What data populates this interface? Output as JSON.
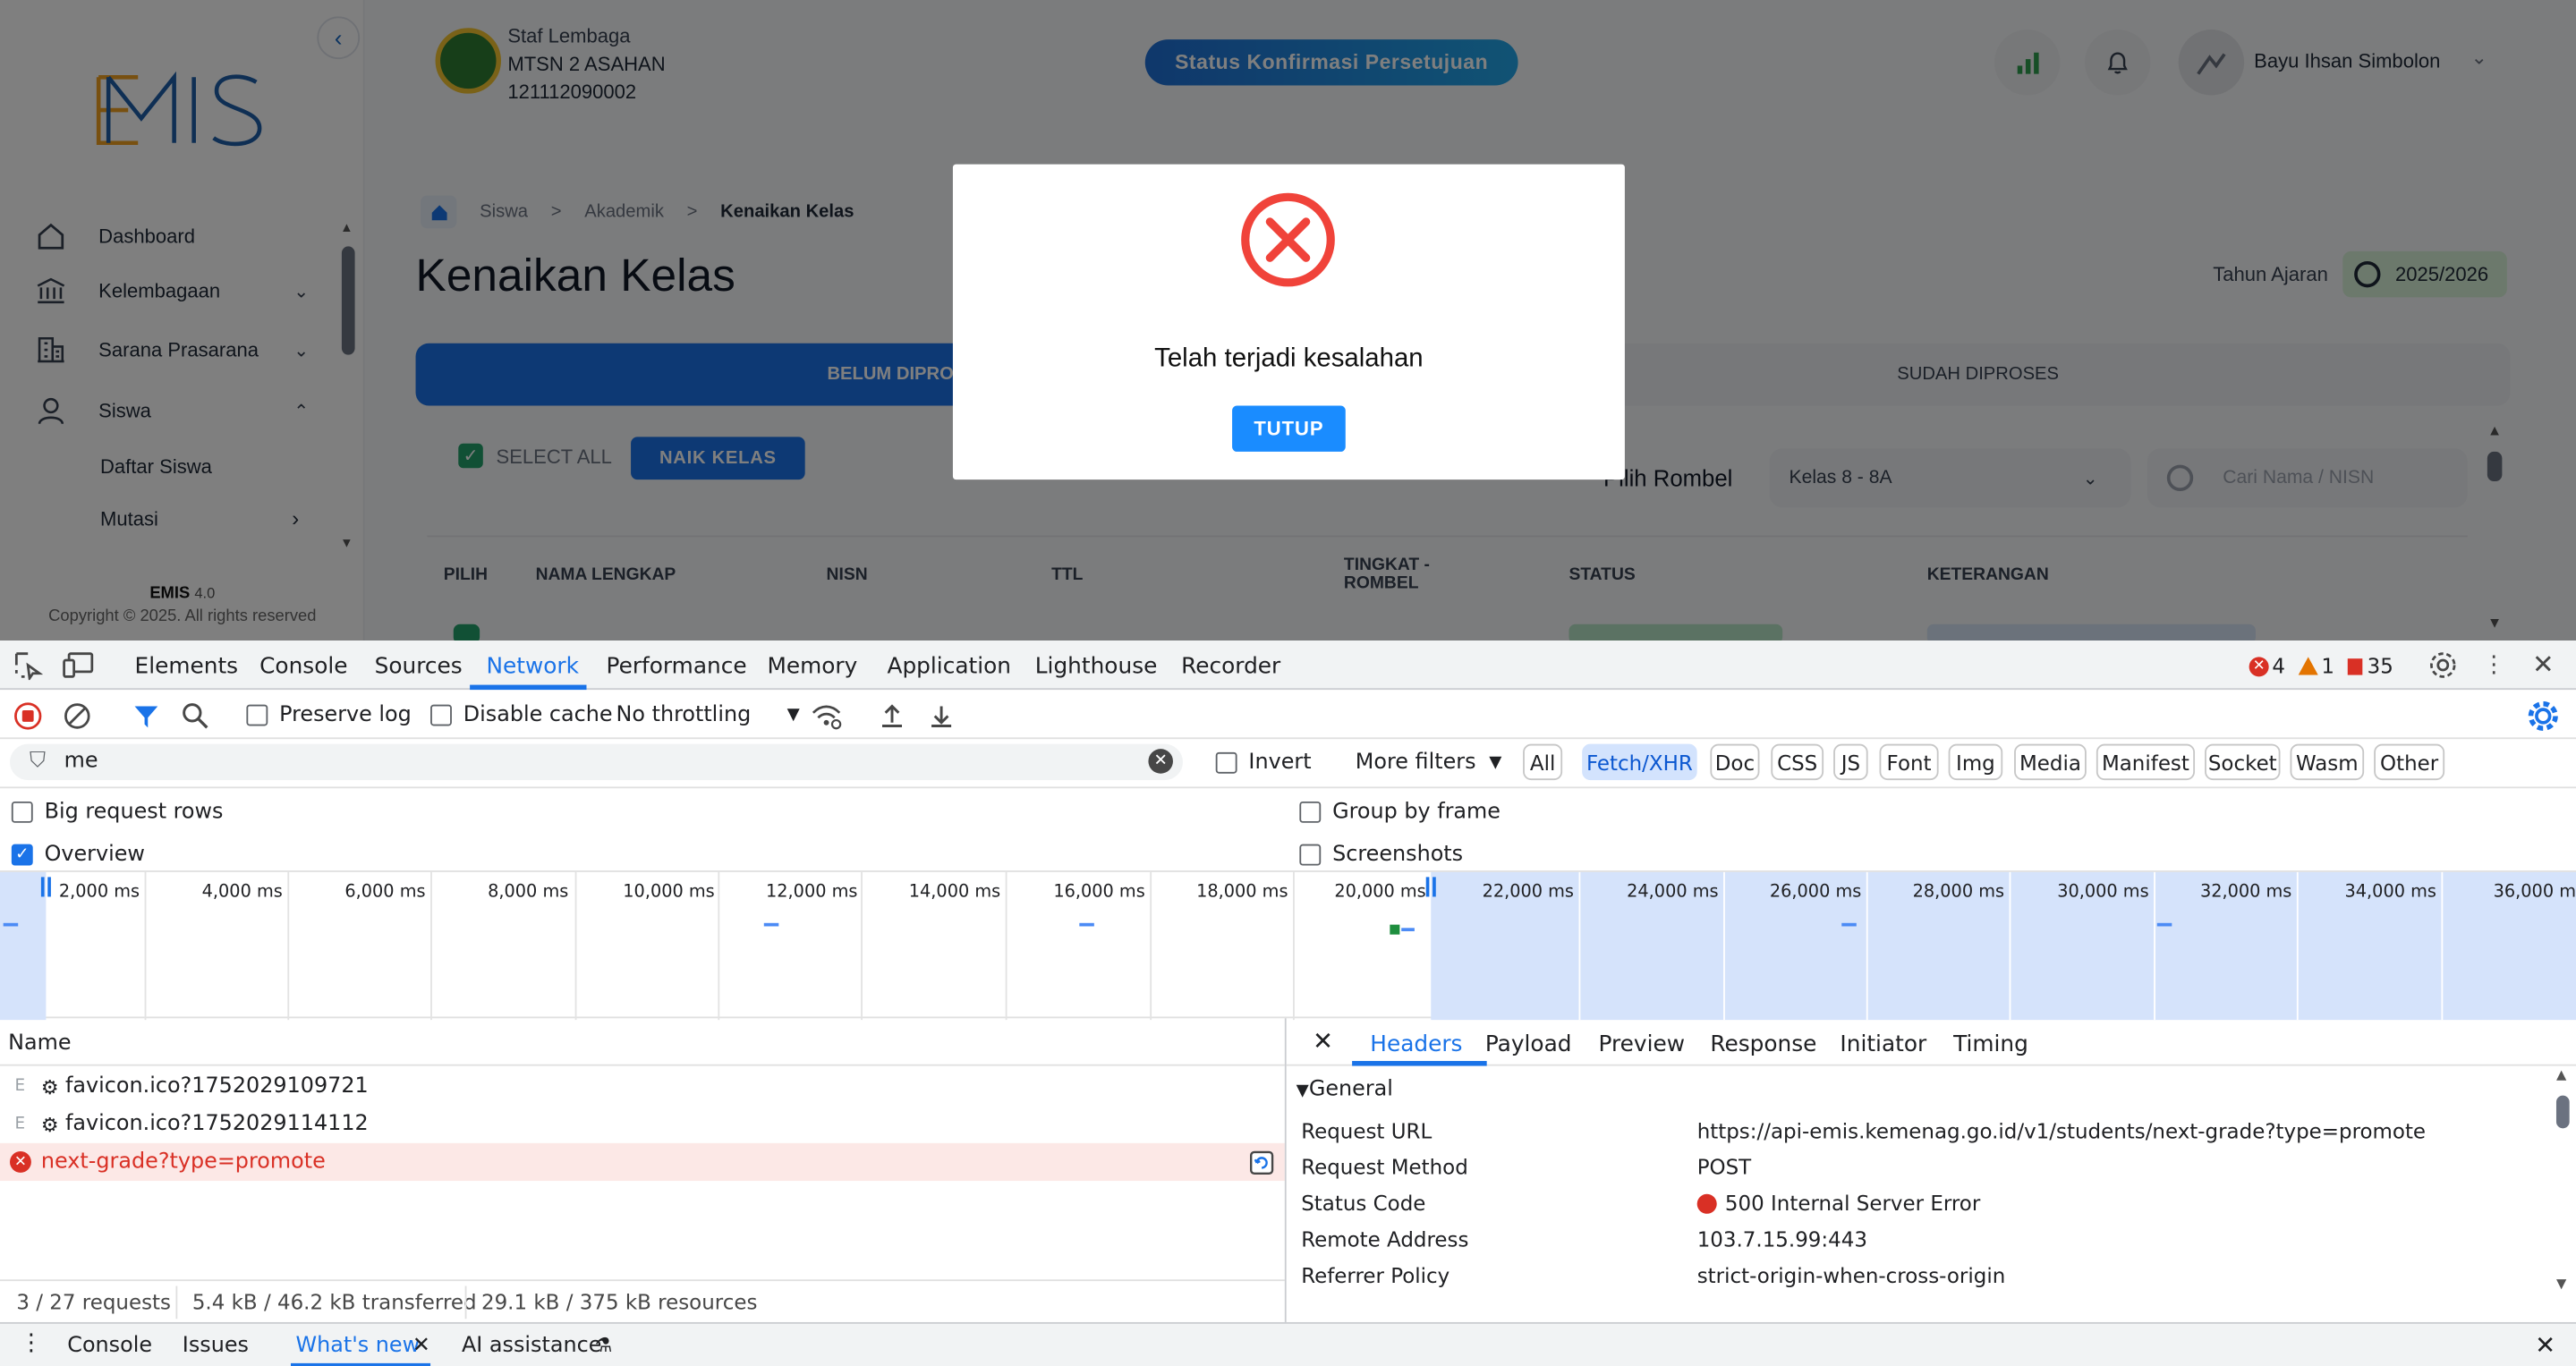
{
  "app": {
    "logo_text": "EMIS",
    "institution": {
      "role": "Staf Lembaga",
      "name": "MTSN 2 ASAHAN",
      "npsn": "121112090002"
    },
    "status_button": "Status Konfirmasi Persetujuan",
    "user_name": "Bayu Ihsan Simbolon",
    "sidebar": {
      "items": [
        {
          "label": "Dashboard",
          "icon": "home-icon"
        },
        {
          "label": "Kelembagaan",
          "icon": "institution-icon"
        },
        {
          "label": "Sarana Prasarana",
          "icon": "building-icon"
        },
        {
          "label": "Siswa",
          "icon": "user-icon"
        }
      ],
      "sub_items": [
        "Daftar Siswa",
        "Mutasi"
      ],
      "footer_app": "EMIS",
      "footer_version": "4.0",
      "footer_copyright": "Copyright © 2025. All rights reserved"
    },
    "breadcrumb": [
      "Siswa",
      "Akademik",
      "Kenaikan Kelas"
    ],
    "breadcrumb_sep": ">",
    "page_title": "Kenaikan Kelas",
    "tahun_ajaran_label": "Tahun Ajaran",
    "tahun_ajaran_value": "2025/2026",
    "tabs": [
      "BELUM DIPROSES",
      "SUDAH DIPROSES"
    ],
    "select_all": "SELECT ALL",
    "naik_kelas": "NAIK KELAS",
    "pilih_rombel_label": "Pilih Rombel",
    "rombel_value": "Kelas 8 - 8A",
    "search_placeholder": "Cari Nama / NISN",
    "columns": [
      "PILIH",
      "NAMA LENGKAP",
      "NISN",
      "TTL",
      "TINGKAT - ROMBEL",
      "STATUS",
      "KETERANGAN"
    ],
    "modal": {
      "message": "Telah terjadi kesalahan",
      "button": "TUTUP"
    }
  },
  "devtools": {
    "panels": [
      "Elements",
      "Console",
      "Sources",
      "Network",
      "Performance",
      "Memory",
      "Application",
      "Lighthouse",
      "Recorder"
    ],
    "active_panel": "Network",
    "errors_count": "4",
    "warnings_count": "1",
    "issues_count": "35",
    "toolbar": {
      "preserve_log": "Preserve log",
      "disable_cache": "Disable cache",
      "throttling": "No throttling"
    },
    "filter_value": "me",
    "invert": "Invert",
    "more_filters": "More filters",
    "type_filters": [
      "All",
      "Fetch/XHR",
      "Doc",
      "CSS",
      "JS",
      "Font",
      "Img",
      "Media",
      "Manifest",
      "Socket",
      "Wasm",
      "Other"
    ],
    "active_type_filter": "Fetch/XHR",
    "options": {
      "big_request_rows": "Big request rows",
      "group_by_frame": "Group by frame",
      "overview": "Overview",
      "screenshots": "Screenshots"
    },
    "timeline_ticks": [
      "2,000 ms",
      "4,000 ms",
      "6,000 ms",
      "8,000 ms",
      "10,000 ms",
      "12,000 ms",
      "14,000 ms",
      "16,000 ms",
      "18,000 ms",
      "20,000 ms",
      "22,000 ms",
      "24,000 ms",
      "26,000 ms",
      "28,000 ms",
      "30,000 ms",
      "32,000 ms",
      "34,000 ms",
      "36,000 m"
    ],
    "name_header": "Name",
    "requests": [
      {
        "name": "favicon.ico?1752029109721",
        "error": false
      },
      {
        "name": "favicon.ico?1752029114112",
        "error": false
      },
      {
        "name": "next-grade?type=promote",
        "error": true
      }
    ],
    "summary": {
      "requests": "3 / 27 requests",
      "transferred": "5.4 kB / 46.2 kB transferred",
      "resources": "29.1 kB / 375 kB resources"
    },
    "detail_tabs": [
      "Headers",
      "Payload",
      "Preview",
      "Response",
      "Initiator",
      "Timing"
    ],
    "active_detail_tab": "Headers",
    "general_header": "General",
    "general": [
      {
        "key": "Request URL",
        "value": "https://api-emis.kemenag.go.id/v1/students/next-grade?type=promote"
      },
      {
        "key": "Request Method",
        "value": "POST"
      },
      {
        "key": "Status Code",
        "value": "500 Internal Server Error"
      },
      {
        "key": "Remote Address",
        "value": "103.7.15.99:443"
      },
      {
        "key": "Referrer Policy",
        "value": "strict-origin-when-cross-origin"
      }
    ],
    "drawer_tabs": [
      "Console",
      "Issues",
      "What's new",
      "AI assistance"
    ],
    "active_drawer_tab": "What's new"
  }
}
